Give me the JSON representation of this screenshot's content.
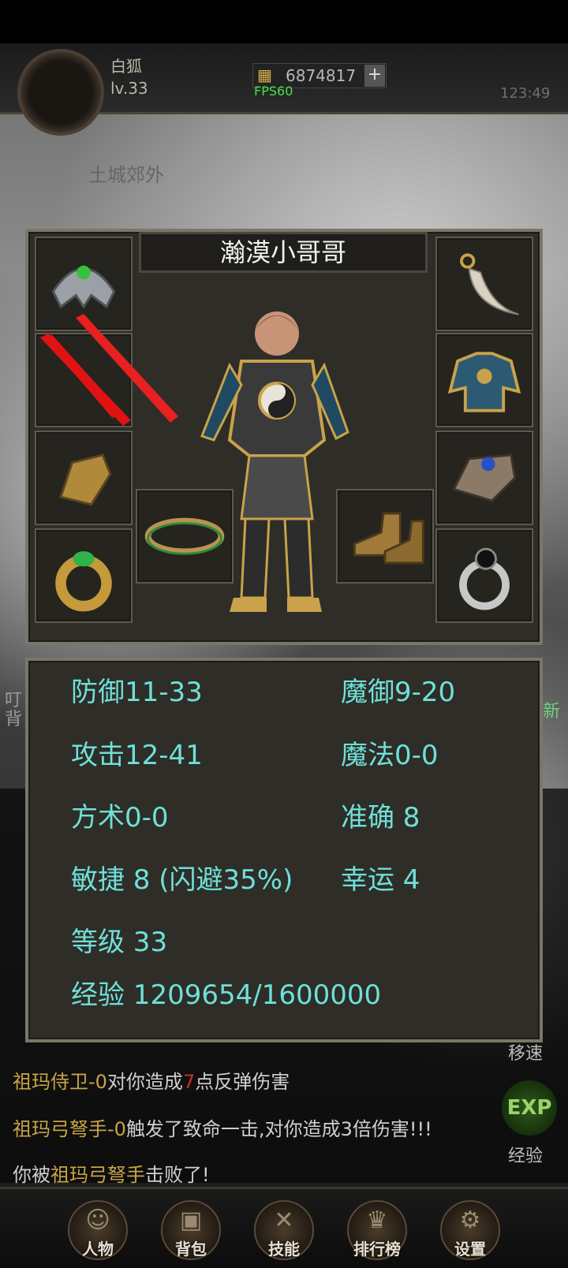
{
  "hud": {
    "player_name": "白狐",
    "player_level": "lv.33",
    "gold": "6874817",
    "plus": "+",
    "fps": "FPS60",
    "coords": "123:49",
    "map_name": "土城郊外"
  },
  "equipment": {
    "character_name": "瀚漠小哥哥",
    "slots": [
      {
        "name": "helmet",
        "icon": "helmet-icon"
      },
      {
        "name": "weapon",
        "icon": "sword-icon"
      },
      {
        "name": "bracer-left",
        "icon": "bracer-icon"
      },
      {
        "name": "ring-left",
        "icon": "ring-icon"
      },
      {
        "name": "necklace",
        "icon": "necklace-icon"
      },
      {
        "name": "armor",
        "icon": "armor-icon"
      },
      {
        "name": "bracer-right",
        "icon": "claw-icon"
      },
      {
        "name": "ring-right",
        "icon": "ring-icon"
      },
      {
        "name": "belt",
        "icon": "belt-icon"
      },
      {
        "name": "boots",
        "icon": "boots-icon"
      }
    ]
  },
  "stats": {
    "defense": "防御11-33",
    "magic_defense": "魔御9-20",
    "attack": "攻击12-41",
    "magic": "魔法0-0",
    "taoism": "方术0-0",
    "accuracy": "准确 8",
    "agility": "敏捷 8 (闪避35%)",
    "luck": "幸运 4",
    "level": "等级 33",
    "exp": "经验 1209654/1600000"
  },
  "side": {
    "left_hint_1": "叮",
    "left_hint_2": "背",
    "right_hint": "新"
  },
  "chat": {
    "line1_a": "祖玛侍卫-0",
    "line1_b": "对你造成",
    "line1_c": "7",
    "line1_d": "点反弹伤害",
    "line2_a": "祖玛弓弩手-0",
    "line2_b": "触发了致命一击,对你造成3倍伤害!!!",
    "line3_a": "你被",
    "line3_b": "祖玛弓弩手",
    "line3_c": "击败了!"
  },
  "right_panel": {
    "move_speed": "移速",
    "exp_badge": "EXP",
    "exp_label": "经验"
  },
  "nav": {
    "character": "人物",
    "bag": "背包",
    "skills": "技能",
    "ranking": "排行榜",
    "settings": "设置"
  },
  "colors": {
    "stat_text": "#6fe0d8",
    "panel_bg": "#2e2d28",
    "panel_border": "#7b7668",
    "chat_yellow": "#c8a446",
    "chat_red": "#c0341e"
  }
}
